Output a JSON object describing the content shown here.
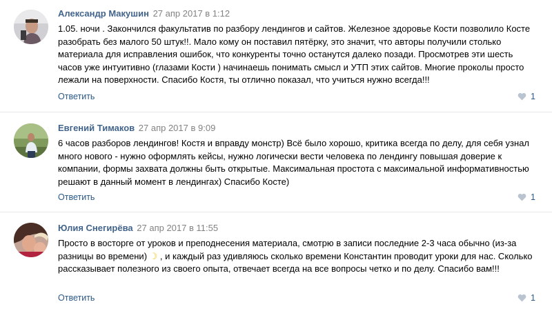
{
  "comments": [
    {
      "author": "Александр Макушин",
      "date": "27 апр 2017 в 1:12",
      "text": "1.05. ночи . Закончился факультатив по разбору лендингов и сайтов. Железное здоровье Кости позволило Косте разобрать без малого 50 штук!!. Мало кому он поставил пятёрку, это значит, что авторы получили столько материала для исправления ошибок, что конкуренты точно останутся далеко позади. Просмотрев эти шесть часов уже интуитивно (глазами Кости ) начинаешь понимать смысл и УТП этих сайтов. Многие проколы просто лежали на поверхности. Спасибо Костя, ты отлично показал, что учиться нужно всегда!!!",
      "reply_label": "Ответить",
      "likes": "1"
    },
    {
      "author": "Евгений Тимаков",
      "date": "27 апр 2017 в 9:09",
      "text": "6 часов разборов лендингов! Костя и вправду монстр) Всё было хорошо, критика всегда по делу, для себя узнал много нового - нужно оформлять кейсы, нужно логически вести человека по лендингу повышая доверие к компании, формы захвата должны быть открытые. Максимальная простота с максимальной информативностью решают в данный момент в лендингах) Спасибо Косте)",
      "reply_label": "Ответить",
      "likes": "1"
    },
    {
      "author": "Юлия Снегирёва",
      "date": "27 апр 2017 в 11:55",
      "text_before_emoji": "Просто в восторге от уроков и преподнесения материала, смотрю в записи последние 2-3 часа обычно (из-за разницы во времени) ",
      "emoji": "☽",
      "text_after_emoji": " , и каждый раз удивляюсь сколько времени Константин проводит уроки для нас. Сколько рассказывает полезного из своего опыта, отвечает всегда на все вопросы четко и по делу. Спасибо вам!!!",
      "reply_label": "Ответить",
      "likes": "1"
    }
  ],
  "colors": {
    "author": "#42648b",
    "date": "#828282",
    "link": "#2a5885",
    "separator": "#e7e8ec",
    "like_icon": "#b9c4d0"
  }
}
